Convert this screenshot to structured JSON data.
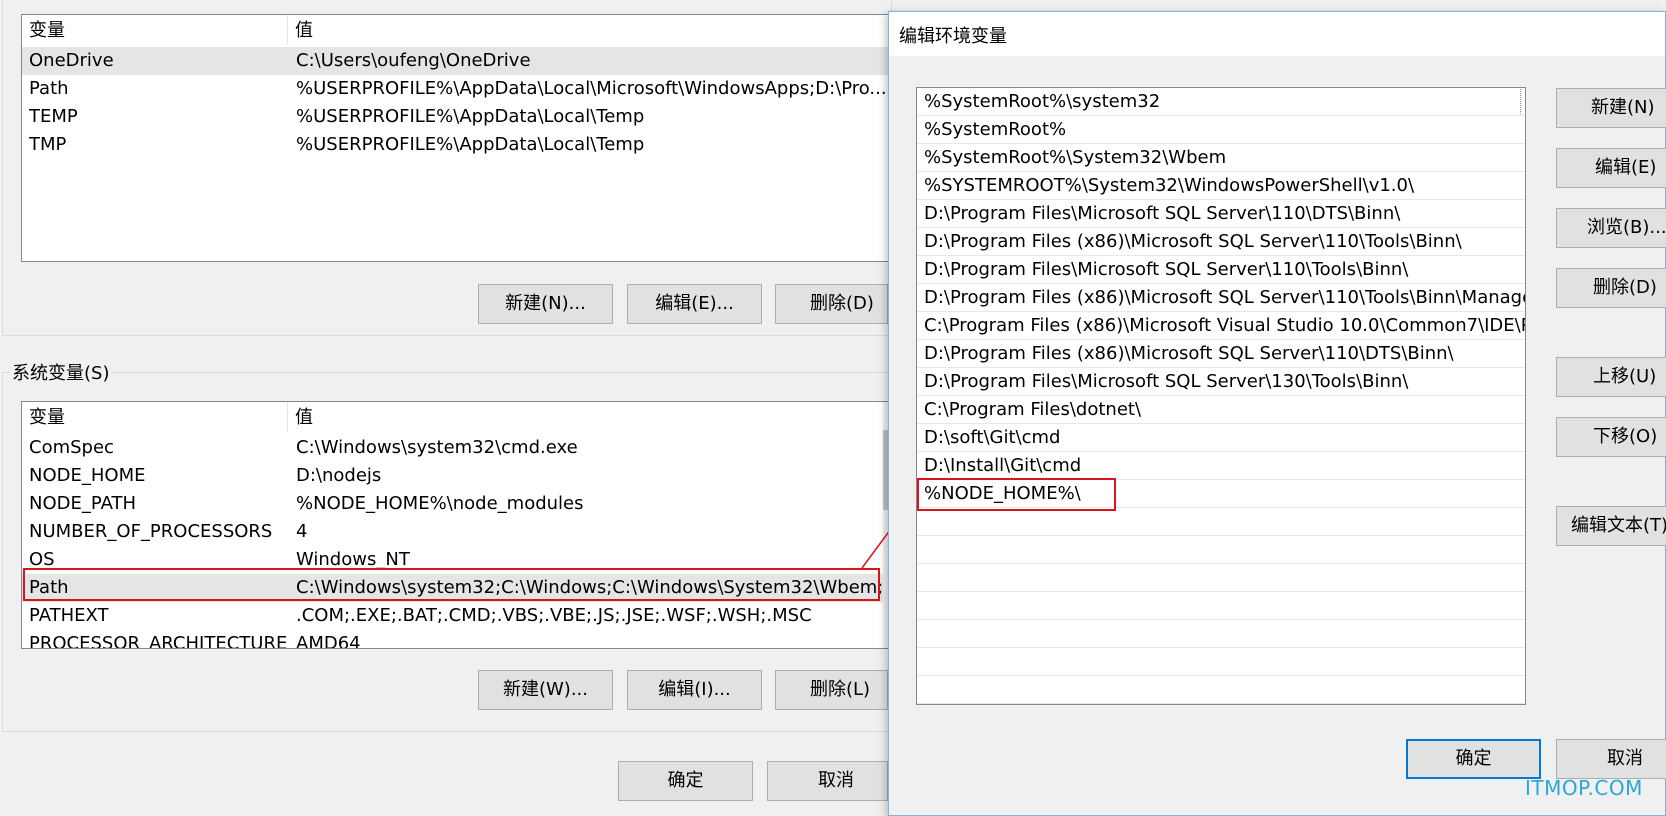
{
  "user_vars": {
    "header": {
      "col_name": "变量",
      "col_value": "值"
    },
    "rows": [
      {
        "name": "OneDrive",
        "value": "C:\\Users\\oufeng\\OneDrive",
        "selected": true
      },
      {
        "name": "Path",
        "value": "%USERPROFILE%\\AppData\\Local\\Microsoft\\WindowsApps;D:\\Pro..."
      },
      {
        "name": "TEMP",
        "value": "%USERPROFILE%\\AppData\\Local\\Temp"
      },
      {
        "name": "TMP",
        "value": "%USERPROFILE%\\AppData\\Local\\Temp"
      }
    ],
    "buttons": {
      "new": "新建(N)...",
      "edit": "编辑(E)...",
      "delete": "删除(D)"
    }
  },
  "system_vars": {
    "group_label": "系统变量(S)",
    "header": {
      "col_name": "变量",
      "col_value": "值"
    },
    "rows": [
      {
        "name": "ComSpec",
        "value": "C:\\Windows\\system32\\cmd.exe"
      },
      {
        "name": "NODE_HOME",
        "value": "D:\\nodejs"
      },
      {
        "name": "NODE_PATH",
        "value": "%NODE_HOME%\\node_modules"
      },
      {
        "name": "NUMBER_OF_PROCESSORS",
        "value": "4"
      },
      {
        "name": "OS",
        "value": "Windows_NT"
      },
      {
        "name": "Path",
        "value": "C:\\Windows\\system32;C:\\Windows;C:\\Windows\\System32\\Wbem;...",
        "selected": true
      },
      {
        "name": "PATHEXT",
        "value": ".COM;.EXE;.BAT;.CMD;.VBS;.VBE;.JS;.JSE;.WSF;.WSH;.MSC"
      },
      {
        "name": "PROCESSOR_ARCHITECTURE",
        "value": "AMD64"
      }
    ],
    "buttons": {
      "new": "新建(W)...",
      "edit": "编辑(I)...",
      "delete": "删除(L)"
    }
  },
  "main_buttons": {
    "ok": "确定",
    "cancel": "取消"
  },
  "dialog": {
    "title": "编辑环境变量",
    "path_entries": [
      "%SystemRoot%\\system32",
      "%SystemRoot%",
      "%SystemRoot%\\System32\\Wbem",
      "%SYSTEMROOT%\\System32\\WindowsPowerShell\\v1.0\\",
      "D:\\Program Files\\Microsoft SQL Server\\110\\DTS\\Binn\\",
      "D:\\Program Files (x86)\\Microsoft SQL Server\\110\\Tools\\Binn\\",
      "D:\\Program Files\\Microsoft SQL Server\\110\\Tools\\Binn\\",
      "D:\\Program Files (x86)\\Microsoft SQL Server\\110\\Tools\\Binn\\Manage...",
      "C:\\Program Files (x86)\\Microsoft Visual Studio 10.0\\Common7\\IDE\\P...",
      "D:\\Program Files (x86)\\Microsoft SQL Server\\110\\DTS\\Binn\\",
      "D:\\Program Files\\Microsoft SQL Server\\130\\Tools\\Binn\\",
      "C:\\Program Files\\dotnet\\",
      "D:\\soft\\Git\\cmd",
      "D:\\Install\\Git\\cmd",
      "%NODE_HOME%\\"
    ],
    "buttons": {
      "new": "新建(N)",
      "edit": "编辑(E)",
      "browse": "浏览(B)...",
      "delete": "删除(D)",
      "move_up": "上移(U)",
      "move_down": "下移(O)",
      "edit_text": "编辑文本(T)",
      "ok": "确定",
      "cancel": "取消"
    }
  },
  "watermark": "ITMOP.COM",
  "colors": {
    "highlight": "#d9141a",
    "accent": "#0078d7",
    "watermark": "#2aa7d8"
  }
}
